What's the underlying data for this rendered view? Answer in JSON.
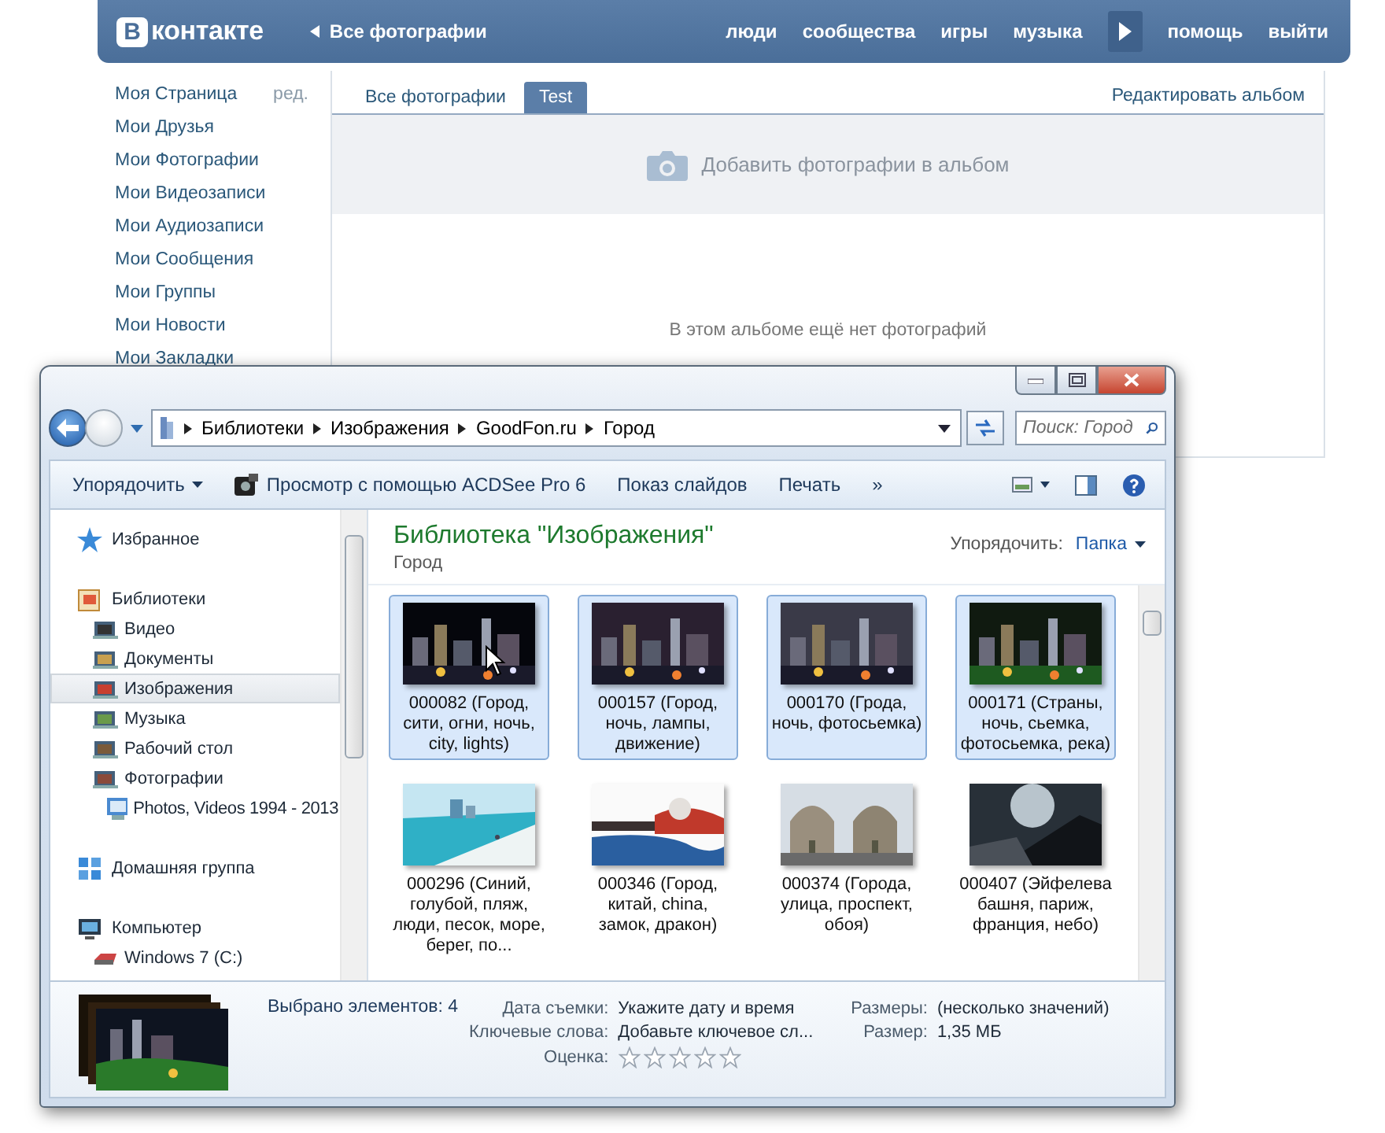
{
  "vk": {
    "logo": {
      "mark": "В",
      "text": "контакте"
    },
    "back_link": "Все фотографии",
    "nav": [
      "люди",
      "сообщества",
      "игры",
      "музыка"
    ],
    "nav_right": [
      "помощь",
      "выйти"
    ],
    "sidebar": {
      "edit_link": "ред.",
      "items": [
        "Моя Страница",
        "Мои Друзья",
        "Мои Фотографии",
        "Мои Видеозаписи",
        "Мои Аудиозаписи",
        "Мои Сообщения",
        "Мои Группы",
        "Мои Новости",
        "Мои Закладки"
      ]
    },
    "tabs": [
      {
        "label": "Все фотографии",
        "selected": false
      },
      {
        "label": "Test",
        "selected": true
      }
    ],
    "edit_album": "Редактировать альбом",
    "add_photos": "Добавить фотографии в альбом",
    "empty_text": "В этом альбоме ещё нет фотографий"
  },
  "explorer": {
    "breadcrumb": [
      "Библиотеки",
      "Изображения",
      "GoodFon.ru",
      "Город"
    ],
    "search": {
      "placeholder": "Поиск: Город"
    },
    "toolbar": [
      {
        "kind": "menu",
        "label": "Упорядочить"
      },
      {
        "kind": "app",
        "label": "Просмотр с помощью ACDSee Pro 6"
      },
      {
        "kind": "plain",
        "label": "Показ слайдов"
      },
      {
        "kind": "plain",
        "label": "Печать"
      },
      {
        "kind": "plain",
        "label": "»"
      }
    ],
    "nav_pane": [
      {
        "label": "Избранное",
        "selected": false
      },
      {
        "label": "Библиотеки",
        "selected": false,
        "children": [
          {
            "label": "Видео",
            "selected": false
          },
          {
            "label": "Документы",
            "selected": false
          },
          {
            "label": "Изображения",
            "selected": true
          },
          {
            "label": "Музыка",
            "selected": false
          },
          {
            "label": "Рабочий стол",
            "selected": false
          },
          {
            "label": "Фотографии",
            "selected": false,
            "children": [
              {
                "label": "Photos, Videos 1994 - 2013",
                "selected": false
              }
            ]
          }
        ]
      },
      {
        "label": "Домашняя группа",
        "selected": false
      },
      {
        "label": "Компьютер",
        "selected": false,
        "children": [
          {
            "label": "Windows 7 (C:)",
            "selected": false
          }
        ]
      }
    ],
    "library": {
      "title": "Библиотека \"Изображения\"",
      "subtitle": "Город",
      "arrange_label": "Упорядочить:",
      "arrange_value": "Папка"
    },
    "items": [
      {
        "caption": "000082 (Город, сити, огни, ночь, city, lights)",
        "selected": true
      },
      {
        "caption": "000157 (Город, ночь, лампы, движение)",
        "selected": true
      },
      {
        "caption": "000170 (Грода, ночь, фотосьемка)",
        "selected": true
      },
      {
        "caption": "000171 (Страны, ночь, сьемка, фотосьемка, река)",
        "selected": true
      },
      {
        "caption": "000296 (Синий, голубой, пляж, люди, песок, море, берег, по...",
        "selected": false
      },
      {
        "caption": "000346 (Город, китай, china, замок, дракон)",
        "selected": false
      },
      {
        "caption": "000374 (Города, улица, проспект, обоя)",
        "selected": false
      },
      {
        "caption": "000407 (Эйфелева башня, париж, франция, небо)",
        "selected": false
      }
    ],
    "details": {
      "selected_count": "Выбрано элементов: 4",
      "fields_left": [
        {
          "label": "Дата съемки:",
          "value": "Укажите дату и время"
        },
        {
          "label": "Ключевые слова:",
          "value": "Добавьте ключевое сл..."
        },
        {
          "label": "Оценка:",
          "stars": 0
        }
      ],
      "fields_right": [
        {
          "label": "Размеры:",
          "value": "(несколько значений)"
        },
        {
          "label": "Размер:",
          "value": "1,35 МБ"
        }
      ]
    }
  }
}
